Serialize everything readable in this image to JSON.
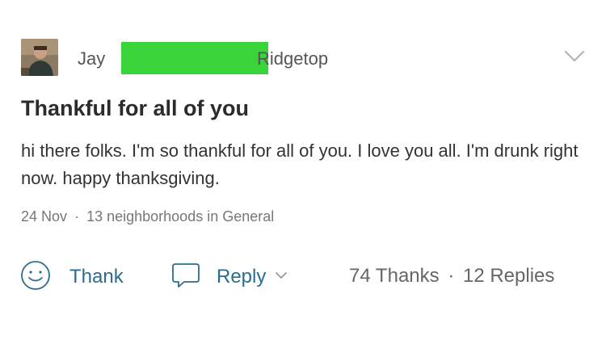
{
  "post": {
    "author_first_name": "Jay",
    "neighborhood_visible": "Ridgetop",
    "title": "Thankful for all of you",
    "body": "hi there folks.  I'm so thankful for all of you.   I love you all.  I'm drunk right now.  happy thanksgiving.",
    "date": "24 Nov",
    "meta_separator": "·",
    "audience": "13 neighborhoods in General"
  },
  "actions": {
    "thank_label": "Thank",
    "reply_label": "Reply",
    "thanks_count": "74 Thanks",
    "count_separator": "·",
    "replies_count": "12 Replies"
  },
  "icons": {
    "avatar": "user-photo",
    "menu": "chevron-down-icon",
    "thank": "smiley-face-icon",
    "reply": "speech-bubble-icon",
    "reply_menu": "chevron-down-icon"
  },
  "colors": {
    "action_blue": "#2b6d8f",
    "redaction_green": "#39d33a"
  }
}
